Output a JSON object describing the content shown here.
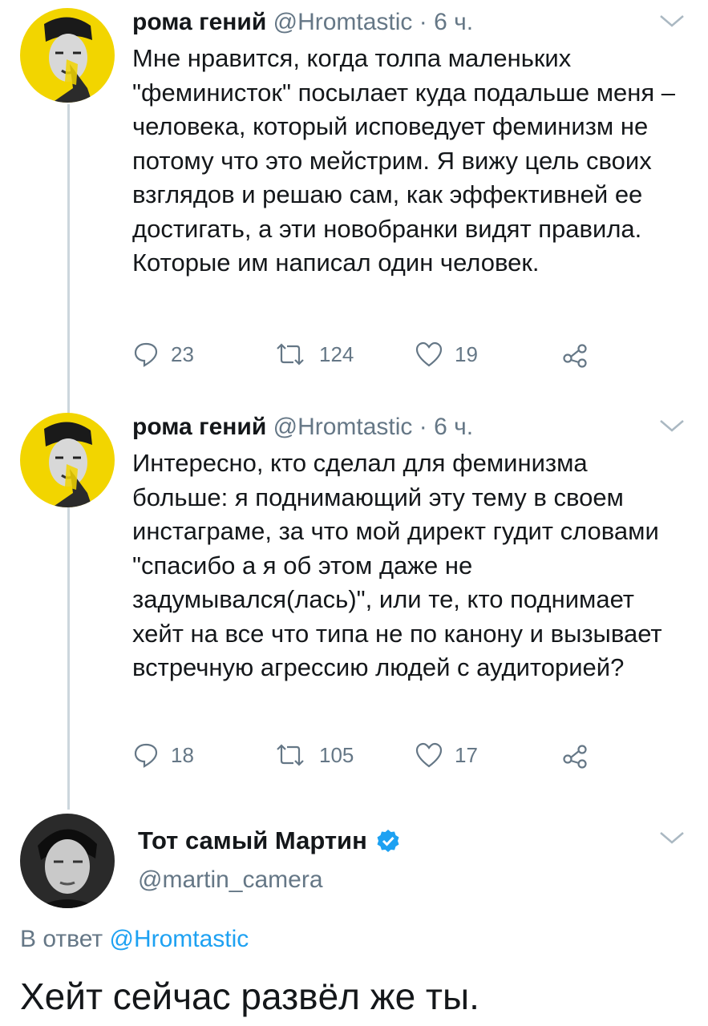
{
  "tweets": [
    {
      "author_name": "рома гений",
      "handle": "@Hromtastic",
      "separator": "·",
      "time": "6 ч.",
      "text": "Мне нравится, когда толпа маленьких \"феминисток\" посылает куда подальше меня – человека, который исповедует феминизм не потому что это мейстрим. Я вижу цель своих взглядов и решаю сам, как эффективней ее достигать, а эти новобранки видят правила. Которые им написал один человек.",
      "replies": "23",
      "retweets": "124",
      "likes": "19"
    },
    {
      "author_name": "рома гений",
      "handle": "@Hromtastic",
      "separator": "·",
      "time": "6 ч.",
      "text": "Интересно, кто сделал для феминизма больше: я поднимающий эту тему в своем инстаграме, за что мой директ гудит словами \"спасибо а я об этом даже не задумывался(лась)\", или те, кто поднимает хейт на все что типа не по канону и вызывает встречную агрессию людей с аудиторией?",
      "replies": "18",
      "retweets": "105",
      "likes": "17"
    }
  ],
  "main_tweet": {
    "author_name": "Тот самый Мартин",
    "handle": "@martin_camera",
    "reply_prefix": "В ответ",
    "reply_mention": "@Hromtastic",
    "text": "Хейт сейчас развёл же ты."
  },
  "icons": {
    "reply": "reply-icon",
    "retweet": "retweet-icon",
    "like": "heart-icon",
    "share": "share-icon",
    "more": "chevron-down-icon",
    "verified": "verified-badge-icon"
  },
  "colors": {
    "text": "#14171a",
    "secondary": "#657786",
    "link": "#1da1f2",
    "avatar_yellow": "#f2d500",
    "thread_line": "#ccd6dd"
  }
}
